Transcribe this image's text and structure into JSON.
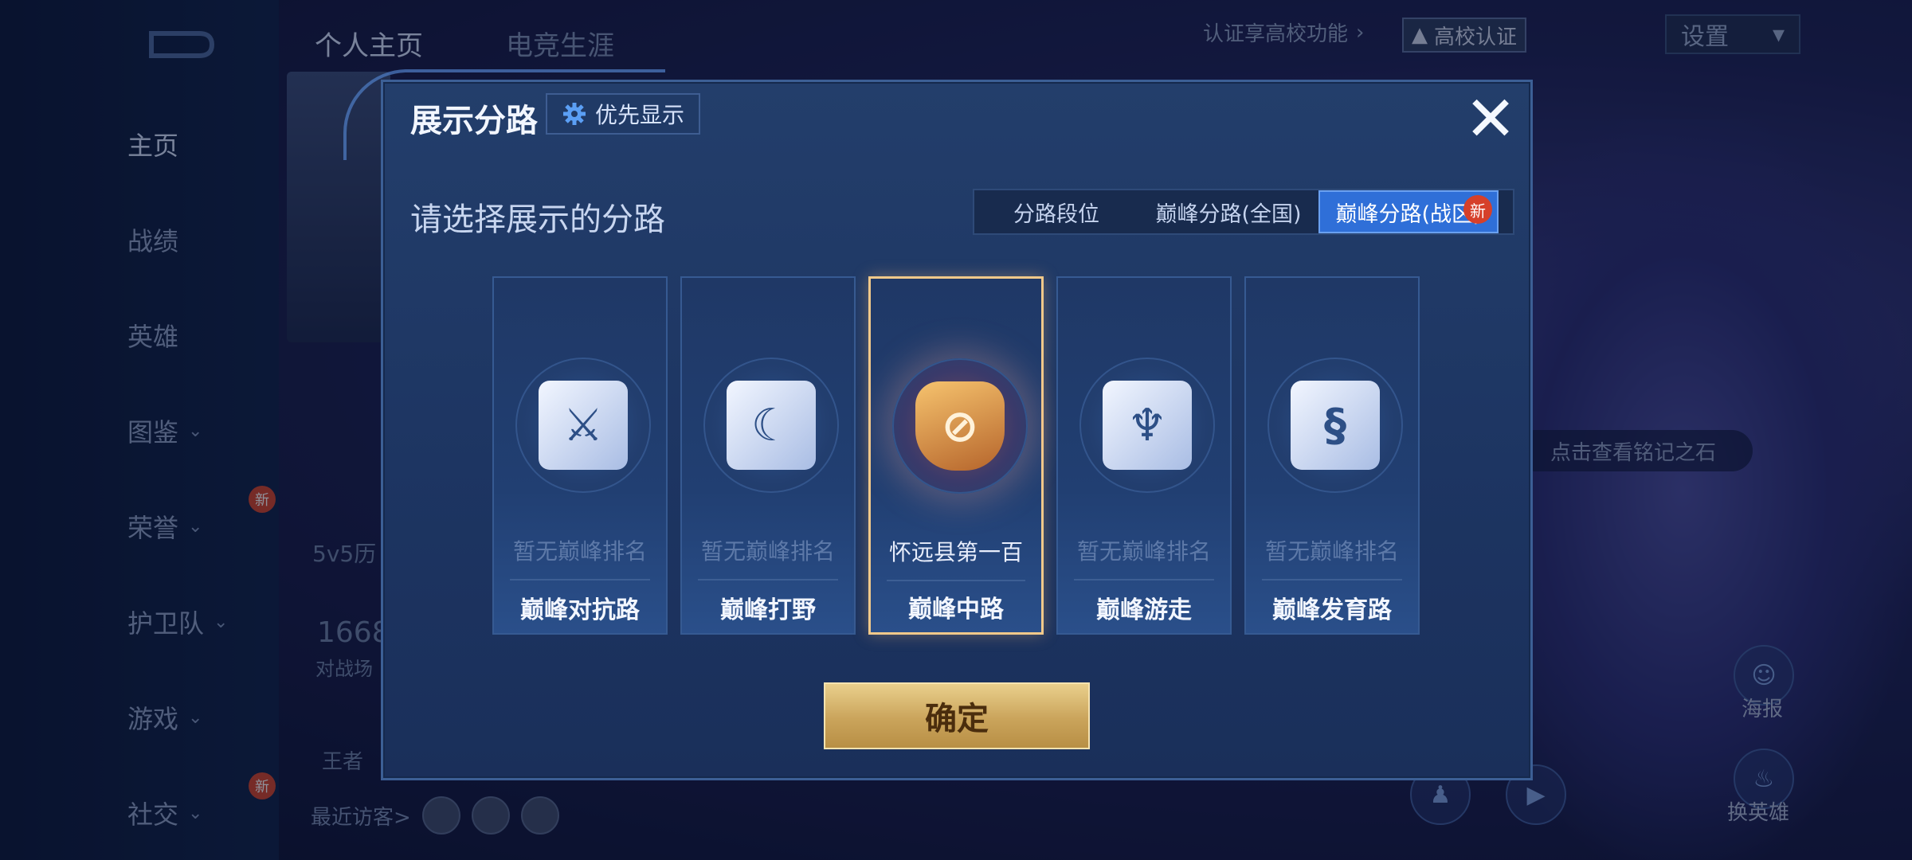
{
  "background": {
    "top_tabs": [
      "个人主页",
      "电竞生涯"
    ],
    "campus_hint": "认证享高校功能",
    "campus_button": "高校认证",
    "settings_label": "设置",
    "nav": [
      {
        "label": "主页",
        "active": true,
        "chevron": false
      },
      {
        "label": "战绩",
        "active": false,
        "chevron": false
      },
      {
        "label": "英雄",
        "active": false,
        "chevron": false
      },
      {
        "label": "图鉴",
        "active": false,
        "chevron": true
      },
      {
        "label": "荣誉",
        "active": false,
        "chevron": true,
        "badge": "新"
      },
      {
        "label": "护卫队",
        "active": false,
        "chevron": true
      },
      {
        "label": "游戏",
        "active": false,
        "chevron": true
      },
      {
        "label": "社交",
        "active": false,
        "chevron": true,
        "badge": "新"
      }
    ],
    "history_label": "5v5历",
    "score_value": "1668",
    "score_label": "对战场",
    "king_label": "王者",
    "recent_visitors": "最近访客>",
    "inscription_hint": "点击查看铭记之石",
    "side_buttons": [
      "海报",
      "换英雄"
    ]
  },
  "modal": {
    "title": "展示分路",
    "priority_button": "优先显示",
    "close_label": "✕",
    "subtitle": "请选择展示的分路",
    "tabs": [
      {
        "label": "分路段位",
        "active": false
      },
      {
        "label": "巅峰分路(全国)",
        "active": false
      },
      {
        "label": "巅峰分路(战区)",
        "active": true,
        "badge": "新"
      }
    ],
    "lanes": [
      {
        "name": "巅峰对抗路",
        "rank": "暂无巅峰排名",
        "selected": false,
        "icon": "sword-lane-icon"
      },
      {
        "name": "巅峰打野",
        "rank": "暂无巅峰排名",
        "selected": false,
        "icon": "dragon-lane-icon"
      },
      {
        "name": "巅峰中路",
        "rank": "怀远县第一百",
        "selected": true,
        "icon": "mid-lane-shield-icon"
      },
      {
        "name": "巅峰游走",
        "rank": "暂无巅峰排名",
        "selected": false,
        "icon": "wings-lane-icon"
      },
      {
        "name": "巅峰发育路",
        "rank": "暂无巅峰排名",
        "selected": false,
        "icon": "marksman-lane-icon"
      }
    ],
    "confirm_button": "确定"
  },
  "colors": {
    "accent_blue": "#2f6fd8",
    "selected_border": "#f2c98a",
    "confirm_gold": "#caa45b",
    "badge_red": "#d6402a"
  }
}
